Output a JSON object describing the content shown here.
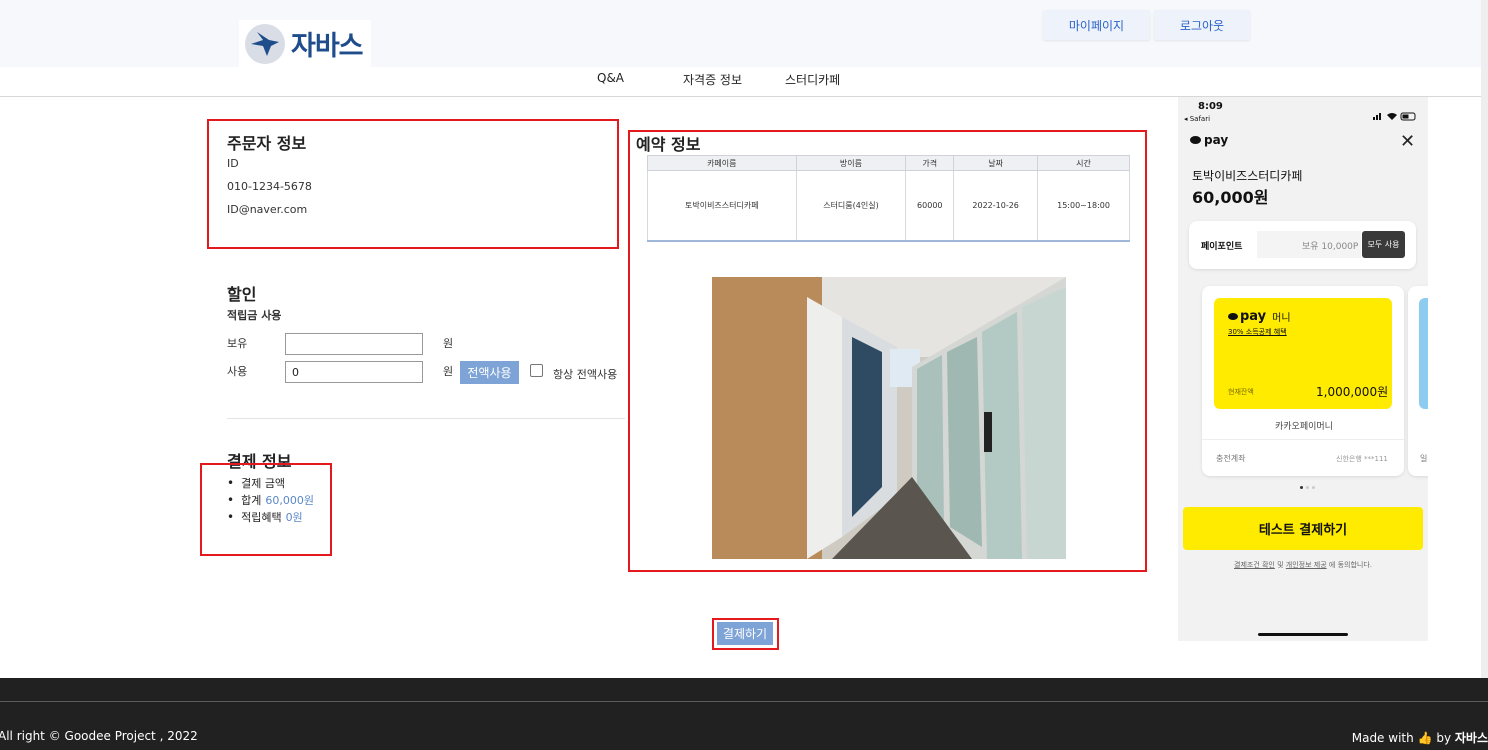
{
  "header": {
    "logo_text": "자바스",
    "mypage_label": "마이페이지",
    "logout_label": "로그아웃",
    "nav": [
      "Q&A",
      "자격증 정보",
      "스터디카페"
    ]
  },
  "orderer": {
    "title": "주문자 정보",
    "id": "ID",
    "phone": "010-1234-5678",
    "email": "ID@naver.com"
  },
  "discount": {
    "title": "할인",
    "subtitle": "적립금 사용",
    "hold_label": "보유",
    "hold_value": "",
    "use_label": "사용",
    "use_value": "0",
    "unit": "원",
    "use_all_label": "전액사용",
    "always_use_all_label": "항상 전액사용"
  },
  "payment_info": {
    "title": "결제 정보",
    "items": {
      "amount_label": "결제 금액",
      "total_label": "합계",
      "total_value": "60,000원",
      "benefit_label": "적립혜택",
      "benefit_value": "0원"
    }
  },
  "reservation": {
    "title": "예약 정보",
    "columns": [
      "카페이름",
      "방이름",
      "가격",
      "날짜",
      "시간"
    ],
    "row": [
      "토박이비즈스터디카페",
      "스터디룸(4인실)",
      "60000",
      "2022-10-26",
      "15:00~18:00"
    ]
  },
  "pay_button_label": "결제하기",
  "footer": {
    "copyright": "All right © Goodee Project , 2022",
    "made_with": "Made with",
    "by": "by",
    "brand": "자바스"
  },
  "phone": {
    "time": "8:09",
    "back_app": "◂ Safari",
    "pay_brand": "pay",
    "store": "토박이비즈스터디카페",
    "amount": "60,000원",
    "point_label": "페이포인트",
    "point_hold": "보유 10,000P",
    "point_use_all": "모두 사용",
    "card_brand": "pay",
    "card_type": "머니",
    "card_promo": "30% 소득공제 혜택",
    "balance_label": "현재잔액",
    "balance_value": "1,000,000원",
    "card_name": "카카오페이머니",
    "charge_label": "충전계좌",
    "charge_account": "신한은행 ***111",
    "next_card_partial": "일",
    "pay_button": "테스트 결제하기",
    "agree_link1": "결제조건 확인",
    "agree_and": "및",
    "agree_link2": "개인정보 제공",
    "agree_tail": "에 동의합니다."
  },
  "colors": {
    "accent_blue": "#7ea3d6",
    "highlight_red": "#e3191e",
    "kakao_yellow": "#ffeb00",
    "footer_bg": "#212121"
  }
}
